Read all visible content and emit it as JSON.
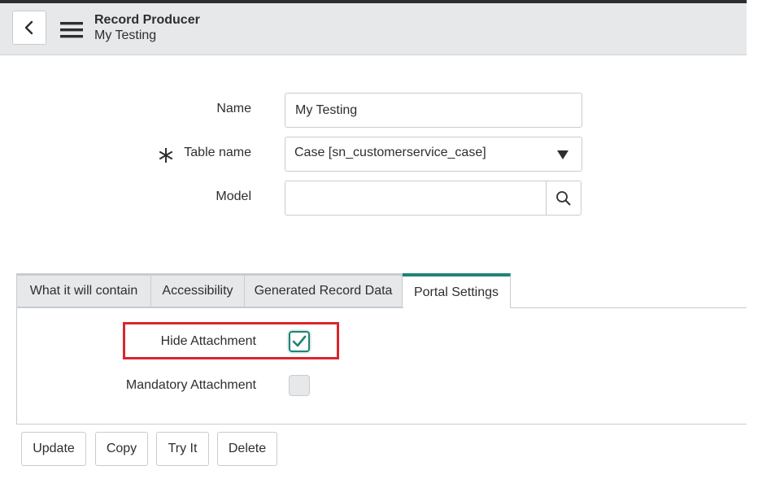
{
  "header": {
    "title": "Record Producer",
    "subtitle": "My Testing"
  },
  "form": {
    "name_label": "Name",
    "name_value": "My Testing",
    "table_label": "Table name",
    "table_value": "Case [sn_customerservice_case]",
    "model_label": "Model",
    "model_value": ""
  },
  "tabs": [
    {
      "label": "What it will contain",
      "active": false
    },
    {
      "label": "Accessibility",
      "active": false
    },
    {
      "label": "Generated Record Data",
      "active": false
    },
    {
      "label": "Portal Settings",
      "active": true
    }
  ],
  "portal_settings": {
    "hide_attachment_label": "Hide Attachment",
    "hide_attachment_checked": true,
    "mandatory_attachment_label": "Mandatory Attachment",
    "mandatory_attachment_checked": false
  },
  "buttons": {
    "update": "Update",
    "copy": "Copy",
    "try_it": "Try It",
    "delete": "Delete"
  },
  "colors": {
    "accent": "#1f8476",
    "highlight": "#d9262f",
    "header_bg": "#e6e8ea"
  },
  "icons": {
    "back": "chevron-left-icon",
    "menu": "hamburger-menu-icon",
    "required": "asterisk-icon",
    "dropdown": "triangle-down-icon",
    "search": "search-icon",
    "check": "checkmark-icon"
  }
}
